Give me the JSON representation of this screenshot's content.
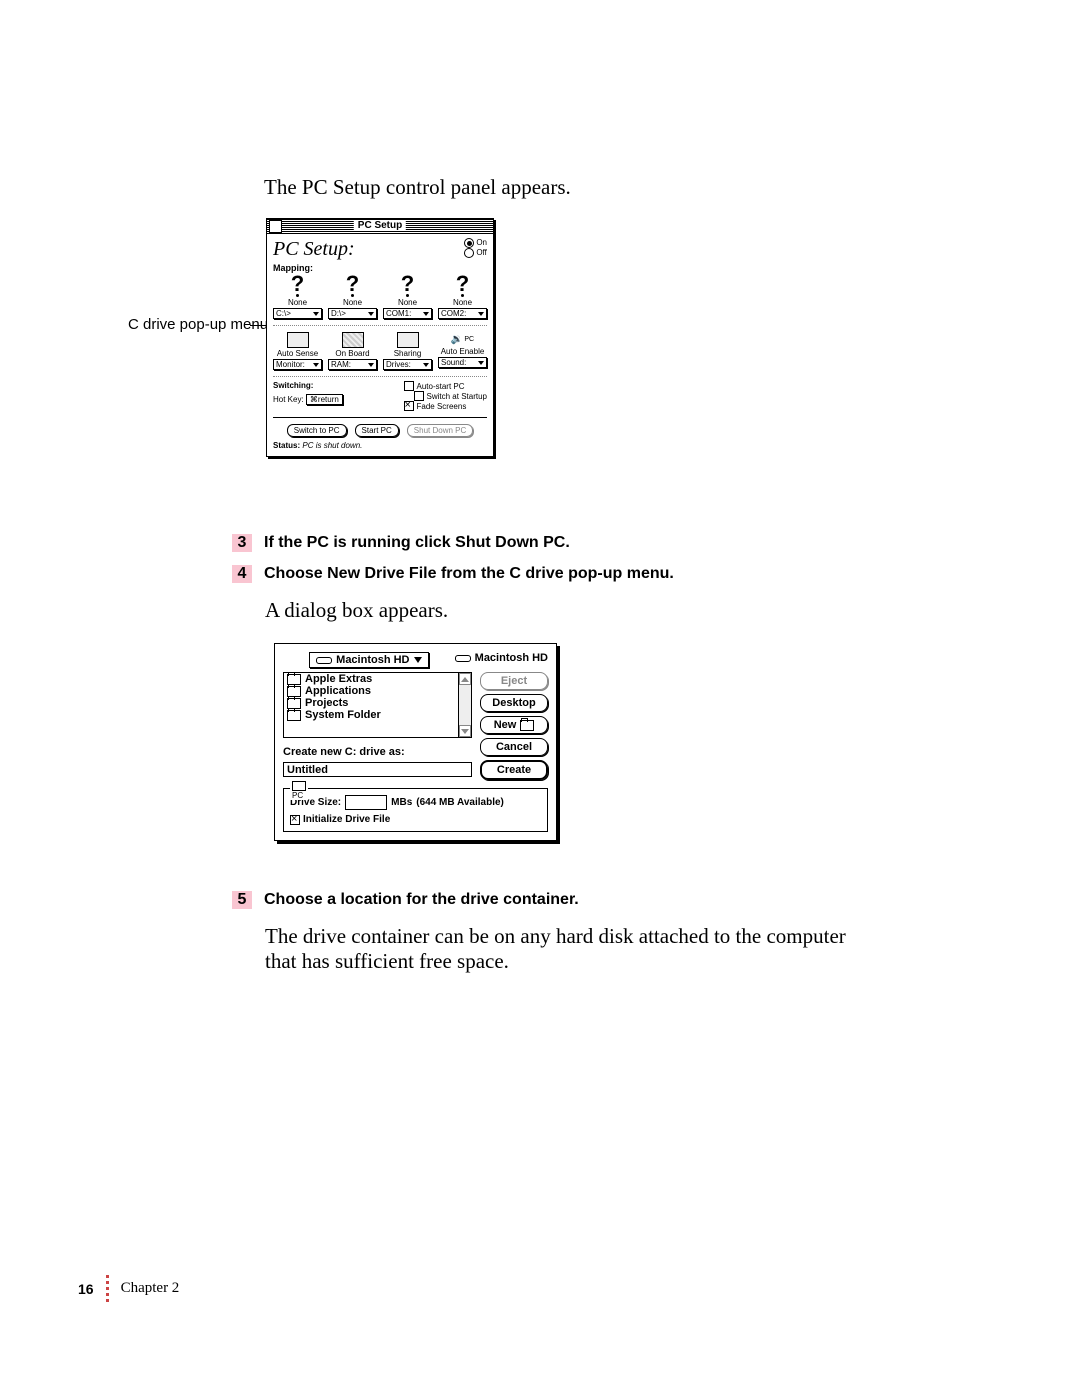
{
  "intro_text": "The PC Setup control panel appears.",
  "callout": "C drive pop-up menu",
  "pcsetup": {
    "window_title": "PC Setup",
    "panel_title": "PC Setup:",
    "on_label": "On",
    "off_label": "Off",
    "mapping_label": "Mapping:",
    "none": "None",
    "popups_row1": [
      "C:\\>",
      "D:\\>",
      "COM1:",
      "COM2:"
    ],
    "row2_labels": [
      "Auto Sense",
      "On Board",
      "Sharing",
      "Auto Enable"
    ],
    "row2_popups": [
      "Monitor:",
      "RAM:",
      "Drives:",
      "Sound:"
    ],
    "row2_icon_pc": "PC",
    "switching_label": "Switching:",
    "hotkey_label": "Hot Key:",
    "hotkey_value": "⌘return",
    "auto_start": "Auto-start PC",
    "switch_startup": "Switch at Startup",
    "fade": "Fade Screens",
    "btn_switch": "Switch to PC",
    "btn_start": "Start PC",
    "btn_shutdown": "Shut Down PC",
    "status_label": "Status:",
    "status_value": "PC is shut down."
  },
  "steps": {
    "s3": {
      "num": "3",
      "text": "If the PC is running click Shut Down PC."
    },
    "s4": {
      "num": "4",
      "text": "Choose New Drive File from the C drive pop-up menu."
    },
    "s4_body": "A dialog box appears.",
    "s5": {
      "num": "5",
      "text": "Choose a location for the drive container."
    },
    "s5_body": "The drive container can be on any hard disk attached to the computer that has sufficient free space."
  },
  "savedlg": {
    "popup_volume": "Macintosh HD",
    "volume": "Macintosh HD",
    "list": [
      "Apple Extras",
      "Applications",
      "Projects",
      "System Folder"
    ],
    "btn_eject": "Eject",
    "btn_desktop": "Desktop",
    "btn_new": "New",
    "btn_cancel": "Cancel",
    "btn_create": "Create",
    "create_label": "Create new C: drive as:",
    "filename": "Untitled",
    "pc_label": "PC",
    "drive_size_label": "Drive Size:",
    "mbs_label": "MBs",
    "available": "(644 MB Available)",
    "init_label": "Initialize Drive File"
  },
  "footer": {
    "page": "16",
    "chapter": "Chapter 2"
  }
}
